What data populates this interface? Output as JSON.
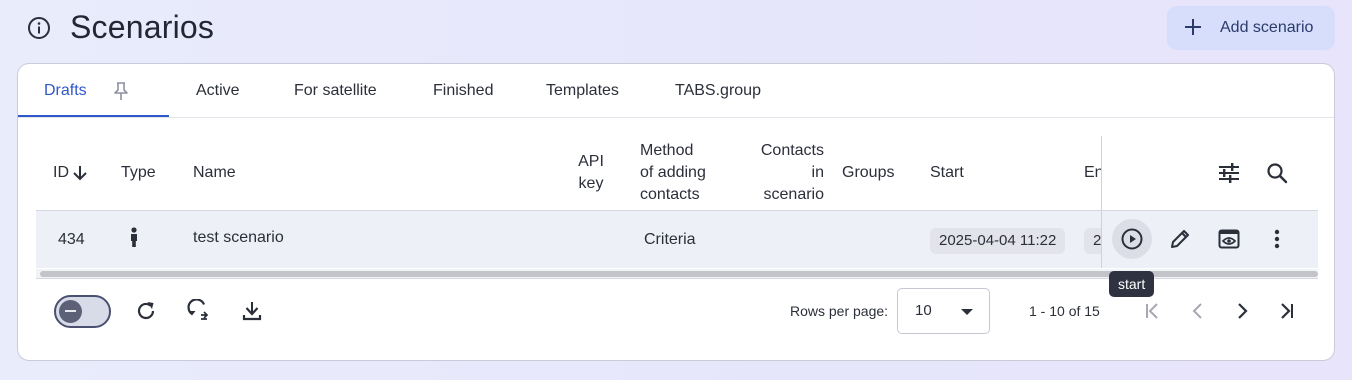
{
  "header": {
    "title": "Scenarios",
    "add_button_label": "Add scenario",
    "accent": "#2f58c9"
  },
  "tabs": [
    {
      "label": "Drafts",
      "active": true,
      "pinned": true
    },
    {
      "label": "Active"
    },
    {
      "label": "For satellite"
    },
    {
      "label": "Finished"
    },
    {
      "label": "Templates"
    },
    {
      "label": "TABS.group"
    }
  ],
  "table": {
    "columns": {
      "id": "ID",
      "type": "Type",
      "name": "Name",
      "api_key_1": "API",
      "api_key_2": "key",
      "method_1": "Method",
      "method_2": "of adding",
      "method_3": "contacts",
      "contacts_1": "Contacts",
      "contacts_2": "in",
      "contacts_3": "scenario",
      "groups": "Groups",
      "start": "Start",
      "end": "En"
    },
    "sort": {
      "column": "ID",
      "direction": "desc"
    },
    "rows": [
      {
        "id": "434",
        "type_icon": "person-icon",
        "name": "test scenario",
        "api_key": "",
        "method": "Criteria",
        "contacts": "",
        "groups": "",
        "start": "2025-04-04 11:22",
        "end": "2"
      }
    ],
    "header_actions": [
      "columns-settings-icon",
      "search-icon"
    ],
    "row_actions": [
      "play-circle-icon",
      "pencil-icon",
      "preview-icon",
      "more-vertical-icon"
    ],
    "tooltip": "start"
  },
  "footer": {
    "toggle_state": "indeterminate",
    "actions": [
      "refresh-icon",
      "auto-refresh-icon",
      "download-icon"
    ],
    "rows_per_page_label": "Rows per page:",
    "rows_per_page_value": "10",
    "range_text": "1 - 10 of 15",
    "pagination": [
      "first-page-icon",
      "prev-page-icon",
      "next-page-icon",
      "last-page-icon"
    ]
  }
}
